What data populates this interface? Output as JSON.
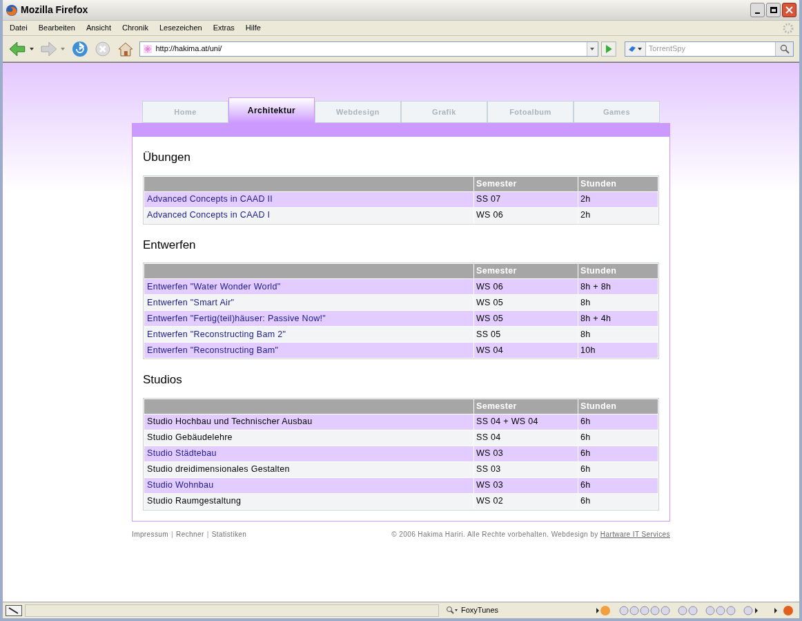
{
  "window": {
    "title": "Mozilla Firefox"
  },
  "menu": [
    "Datei",
    "Bearbeiten",
    "Ansicht",
    "Chronik",
    "Lesezeichen",
    "Extras",
    "Hilfe"
  ],
  "address_bar": {
    "value": "http://hakima.at/uni/"
  },
  "search_bar": {
    "placeholder": "TorrentSpy"
  },
  "tabs": [
    {
      "label": "Home",
      "selected": false
    },
    {
      "label": "Architektur",
      "selected": true
    },
    {
      "label": "Webdesign",
      "selected": false
    },
    {
      "label": "Grafik",
      "selected": false
    },
    {
      "label": "Fotoalbum",
      "selected": false
    },
    {
      "label": "Games",
      "selected": false
    }
  ],
  "sections": [
    {
      "heading": "Übungen",
      "columns": [
        "Semester",
        "Stunden"
      ],
      "rows": [
        {
          "kind": "link",
          "name": "Advanced Concepts in CAAD II",
          "semester": "SS 07",
          "stunden": "2h"
        },
        {
          "kind": "link",
          "name": "Advanced Concepts in CAAD I",
          "semester": "WS 06",
          "stunden": "2h"
        }
      ]
    },
    {
      "heading": "Entwerfen",
      "columns": [
        "Semester",
        "Stunden"
      ],
      "rows": [
        {
          "kind": "link",
          "name": "Entwerfen \"Water Wonder World\"",
          "semester": "WS 06",
          "stunden": "8h + 8h"
        },
        {
          "kind": "link",
          "name": "Entwerfen \"Smart Air\"",
          "semester": "WS 05",
          "stunden": "8h"
        },
        {
          "kind": "link",
          "name": "Entwerfen \"Fertig(teil)häuser: Passive Now!\"",
          "semester": "WS 05",
          "stunden": "8h + 4h"
        },
        {
          "kind": "link",
          "name": "Entwerfen \"Reconstructing Bam 2\"",
          "semester": "SS 05",
          "stunden": "8h"
        },
        {
          "kind": "link",
          "name": "Entwerfen \"Reconstructing Bam\"",
          "semester": "WS 04",
          "stunden": "10h"
        }
      ]
    },
    {
      "heading": "Studios",
      "columns": [
        "Semester",
        "Stunden"
      ],
      "rows": [
        {
          "kind": "text",
          "name": "Studio Hochbau und Technischer Ausbau",
          "semester": "SS 04 + WS 04",
          "stunden": "6h"
        },
        {
          "kind": "text",
          "name": "Studio Gebäudelehre",
          "semester": "SS 04",
          "stunden": "6h"
        },
        {
          "kind": "link",
          "name": "Studio Städtebau",
          "semester": "WS 03",
          "stunden": "6h"
        },
        {
          "kind": "text",
          "name": "Studio dreidimensionales Gestalten",
          "semester": "SS 03",
          "stunden": "6h"
        },
        {
          "kind": "link",
          "name": "Studio Wohnbau",
          "semester": "WS 03",
          "stunden": "6h"
        },
        {
          "kind": "text",
          "name": "Studio Raumgestaltung",
          "semester": "WS 02",
          "stunden": "6h"
        }
      ]
    }
  ],
  "footer": {
    "left": [
      {
        "kind": "link",
        "text": "Impressum"
      },
      {
        "kind": "separator",
        "text": "|"
      },
      {
        "kind": "link",
        "text": "Rechner"
      },
      {
        "kind": "separator",
        "text": "|"
      },
      {
        "kind": "link",
        "text": "Statistiken"
      }
    ],
    "copyright": "© 2006 Hakima Hariri. Alle Rechte vorbehalten. Webdesign by",
    "credit_link": "Hartware IT Services"
  },
  "status_bar": {
    "foxytunes": "FoxyTunes"
  }
}
